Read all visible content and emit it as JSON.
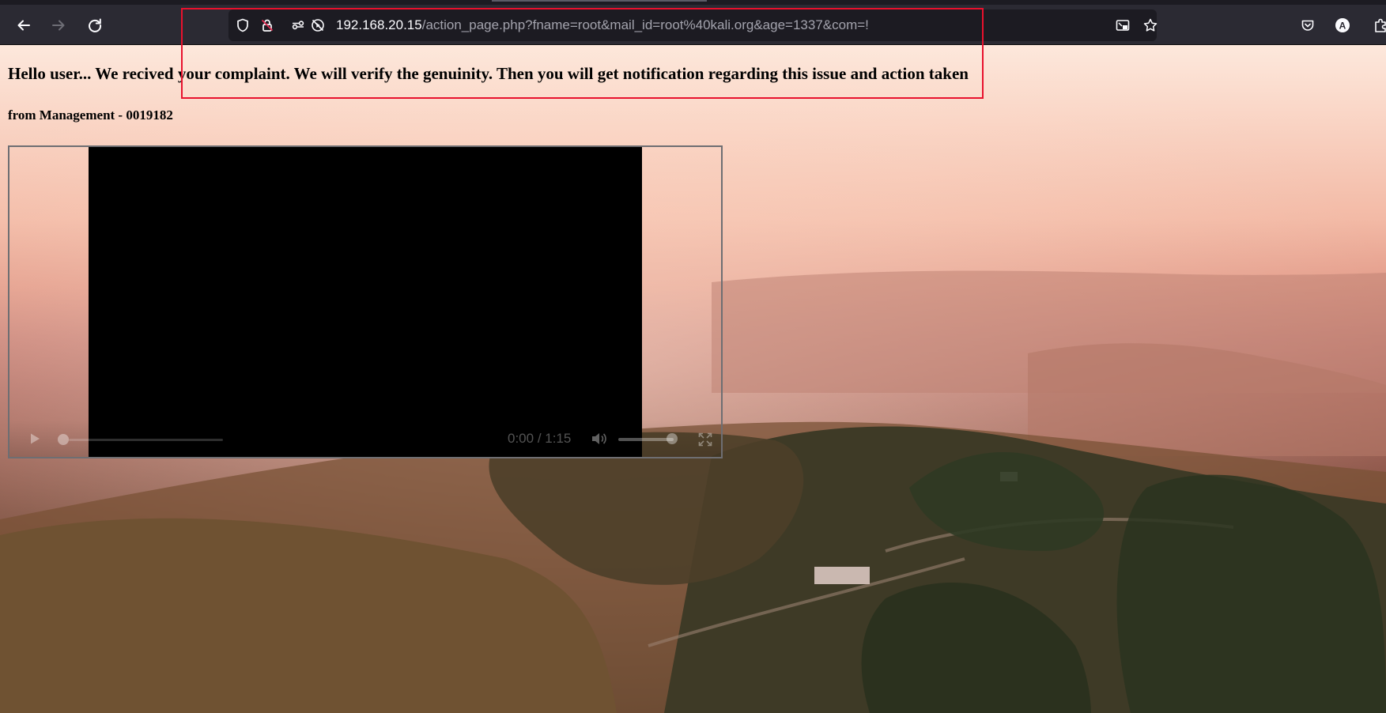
{
  "browser": {
    "url_host": "192.168.20.15",
    "url_path": "/action_page.php?fname=root&mail_id=root%40kali.org&age=1337&com=!",
    "profile_initial": "A",
    "icons": {
      "back": "back-arrow-icon",
      "forward": "forward-arrow-icon",
      "reload": "reload-icon",
      "tracking": "tracking-protection-shield-icon",
      "lock": "insecure-lock-icon",
      "permissions": "permissions-icon",
      "blocked": "autoplay-blocked-icon",
      "pip": "picture-in-picture-icon",
      "bookmark": "bookmark-star-icon",
      "pocket": "pocket-icon",
      "account": "account-avatar-icon",
      "extensions": "extensions-puzzle-icon"
    }
  },
  "page": {
    "heading": "Hello user... We recived your complaint. We will verify the genuinity. Then you will get notification regarding this issue and action taken",
    "subheading": "from Management - 0019182"
  },
  "video": {
    "time_current": "0:00",
    "time_total": "1:15",
    "time_separator": " / ",
    "progress": 0,
    "volume": 1.0
  },
  "colors": {
    "toolbar": "#2b2a33",
    "urlbar": "#1c1b22",
    "annotation": "#e8112d"
  }
}
